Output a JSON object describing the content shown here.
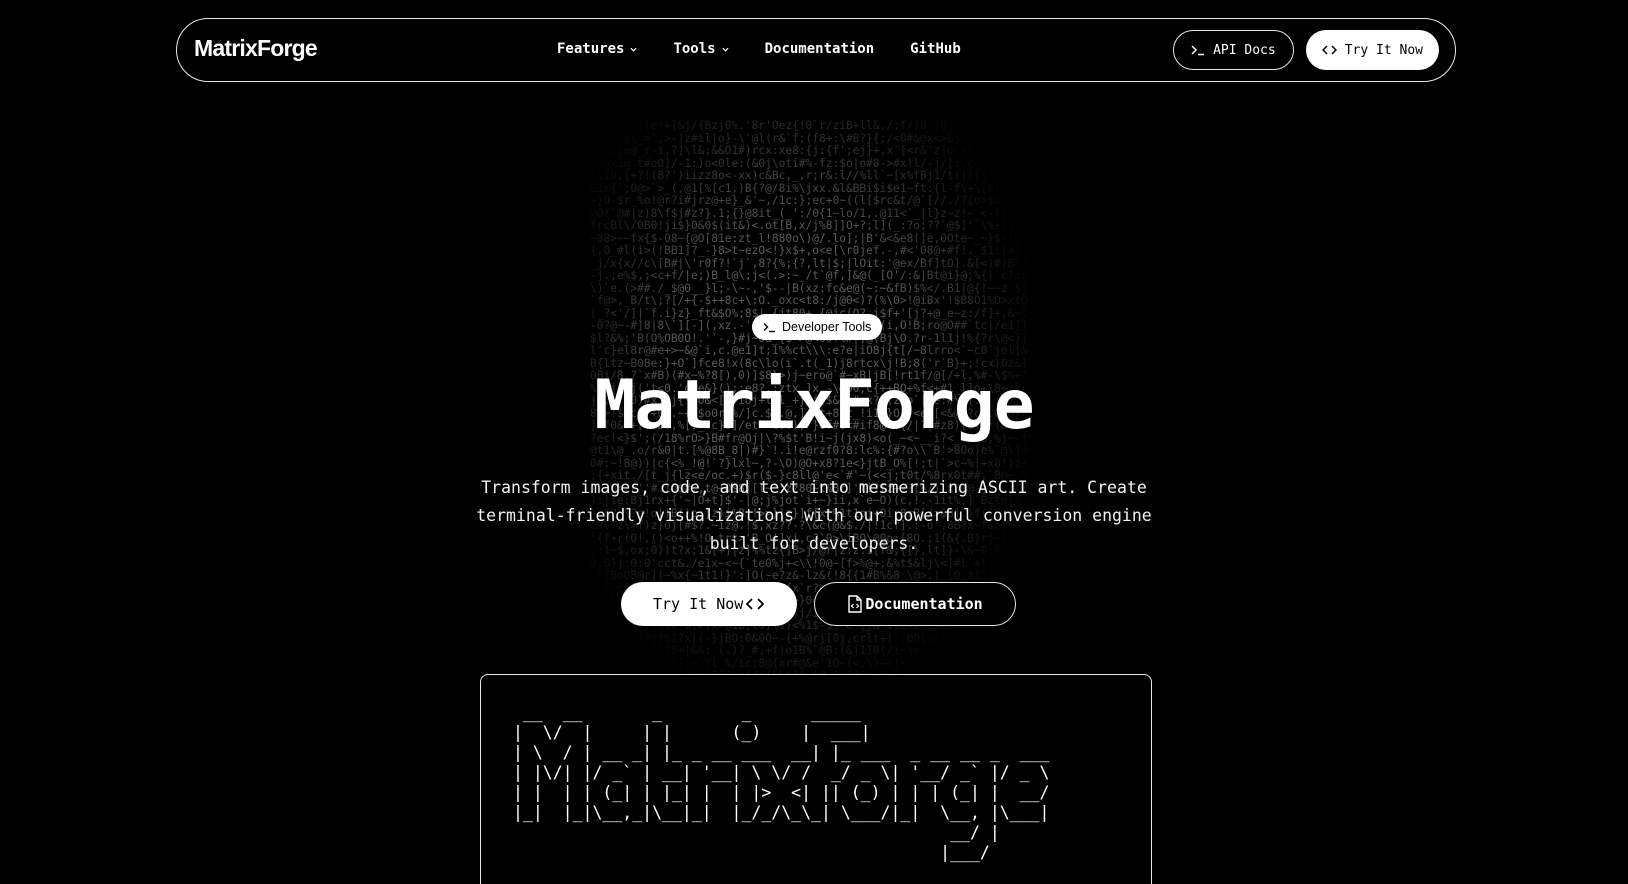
{
  "nav": {
    "logo": "MatrixForge",
    "links": [
      {
        "label": "Features",
        "has_dropdown": true
      },
      {
        "label": "Tools",
        "has_dropdown": true
      },
      {
        "label": "Documentation",
        "has_dropdown": false
      },
      {
        "label": "GitHub",
        "has_dropdown": false
      }
    ],
    "api_docs_label": "API Docs",
    "try_label": "Try It Now"
  },
  "hero": {
    "badge": "Developer Tools",
    "title": "MatrixForge",
    "subtitle": "Transform images, code, and text into mesmerizing ASCII art. Create terminal-friendly visualizations with our powerful conversion engine built for developers.",
    "primary_cta": "Try It Now",
    "secondary_cta": "Documentation"
  },
  "terminal": {
    "ascii_art": " __  __       _        _      _____\n|  \\/  |     | |      (_)    |  ___|\n| \\  / | __ _| |_ _ __ ___  __| |_ ___  _ __ __ _  ___\n| |\\/| |/ _` | __| '__| \\ \\/ /  _/ _ \\| '__/ _` |/ _ \\\n| |  | | (_| | |_| |  | |>  <| || (_) | | | (_| |  __/\n|_|  |_|\\__,_|\\__|_|  |_/_/\\_\\_| \\___/|_|  \\__, |\\___|\n                                            __/ |\n                                           |___/"
  },
  "colors": {
    "background": "#000000",
    "foreground": "#ffffff",
    "border": "#e8e8e8",
    "ascii_background": "#6b6b6b"
  },
  "icons": [
    "chevron-down-icon",
    "terminal-prompt-icon",
    "code-brackets-icon",
    "file-code-icon"
  ]
}
